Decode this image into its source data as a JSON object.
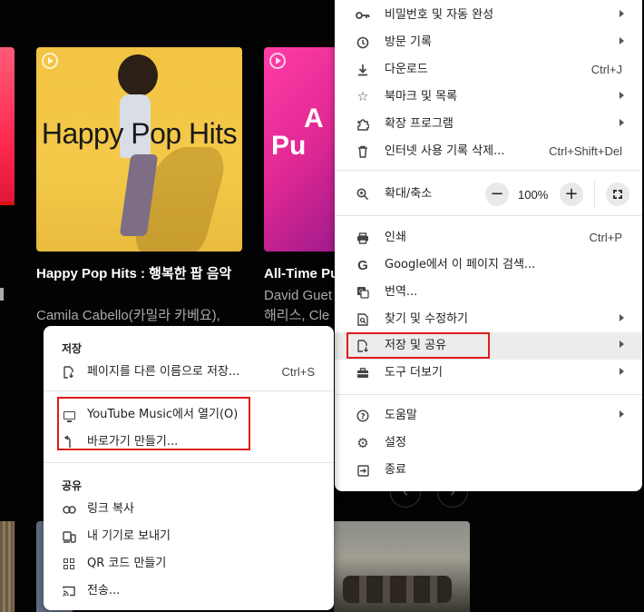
{
  "background": {
    "cards": [
      {
        "title": "Happy Pop Hits : 행복한 팝 음악",
        "subtitle": "Camila Cabello(카밀라 카베요),",
        "cover_text": "Happy Pop Hits"
      },
      {
        "title": "All-Time Pu",
        "subtitle_line1": "David Guet",
        "subtitle_line2": "해리스, Cle",
        "cover_text_line1": "A",
        "cover_text_line2": "Pu"
      }
    ],
    "colors": {
      "page_bg": "#030303",
      "happy_cover": "#f2c443",
      "alltime_cover": "#e12894"
    }
  },
  "main_menu": {
    "items": [
      {
        "label": "비밀번호 및 자동 완성",
        "icon": "key-icon",
        "has_submenu": true
      },
      {
        "label": "방문 기록",
        "icon": "history-icon",
        "has_submenu": true
      },
      {
        "label": "다운로드",
        "icon": "download-icon",
        "shortcut": "Ctrl+J"
      },
      {
        "label": "북마크 및 목록",
        "icon": "star-icon",
        "has_submenu": true
      },
      {
        "label": "확장 프로그램",
        "icon": "puzzle-icon",
        "has_submenu": true
      },
      {
        "label": "인터넷 사용 기록 삭제...",
        "icon": "trash-icon",
        "shortcut": "Ctrl+Shift+Del"
      }
    ],
    "zoom": {
      "label": "확대/축소",
      "minus": "−",
      "value": "100%",
      "plus": "+",
      "icon": "zoom-icon"
    },
    "items2": [
      {
        "label": "인쇄",
        "icon": "printer-icon",
        "shortcut": "Ctrl+P"
      },
      {
        "label": "Google에서 이 페이지 검색...",
        "icon": "google-icon"
      },
      {
        "label": "번역...",
        "icon": "translate-icon"
      },
      {
        "label": "찾기 및 수정하기",
        "icon": "find-icon",
        "has_submenu": true
      },
      {
        "label": "저장 및 공유",
        "icon": "save-share-icon",
        "has_submenu": true,
        "highlighted": true
      },
      {
        "label": "도구 더보기",
        "icon": "toolbox-icon",
        "has_submenu": true
      }
    ],
    "items3": [
      {
        "label": "도움말",
        "icon": "help-icon",
        "has_submenu": true
      },
      {
        "label": "설정",
        "icon": "settings-icon"
      },
      {
        "label": "종료",
        "icon": "exit-icon"
      }
    ]
  },
  "submenu": {
    "save_heading": "저장",
    "save_page": {
      "label": "페이지를 다른 이름으로 저장...",
      "shortcut": "Ctrl+S"
    },
    "open_in_app": {
      "label": "YouTube Music에서 열기(O)"
    },
    "create_shortcut": {
      "label": "바로가기 만들기..."
    },
    "share_heading": "공유",
    "share_items": [
      {
        "label": "링크 복사",
        "icon": "link-icon"
      },
      {
        "label": "내 기기로 보내기",
        "icon": "devices-icon"
      },
      {
        "label": "QR 코드 만들기",
        "icon": "qr-code-icon"
      },
      {
        "label": "전송...",
        "icon": "cast-icon"
      }
    ]
  },
  "colors": {
    "highlight_box": "#e01b1b",
    "menu_bg": "#ffffff",
    "menu_hover": "#ececec"
  }
}
